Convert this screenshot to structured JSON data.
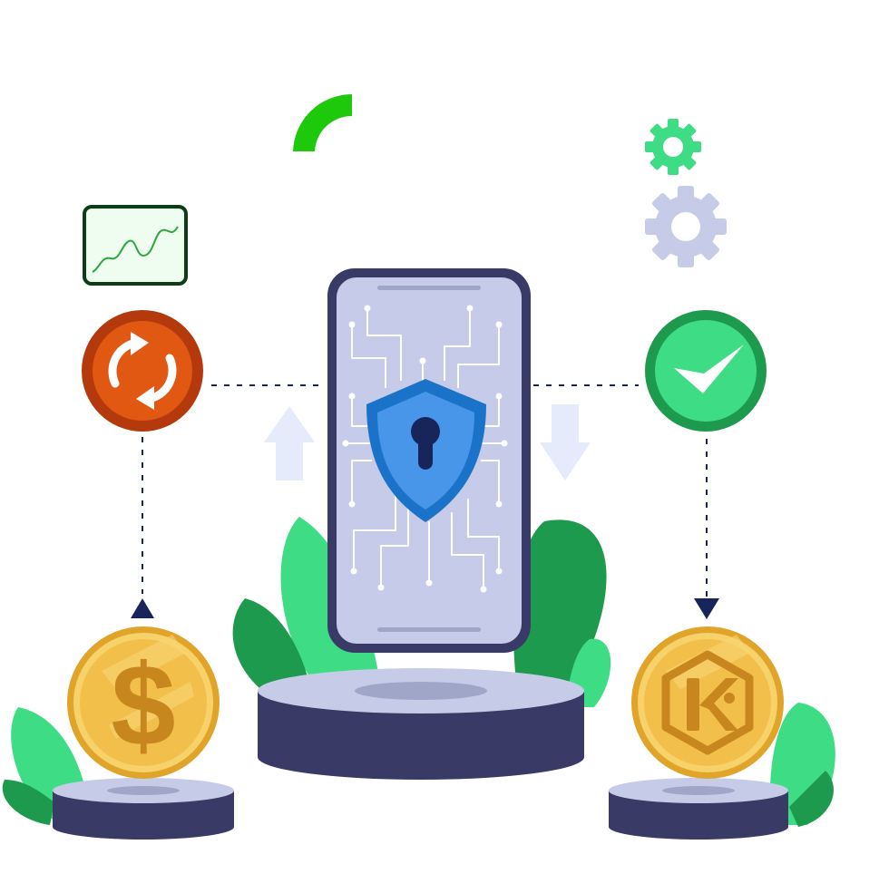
{
  "illustration": {
    "theme": "secure-crypto-exchange",
    "colors": {
      "leaf_light": "#3fdc86",
      "leaf_dark": "#1e9a4e",
      "pedestal_top": "#c6cbe8",
      "pedestal_side": "#3a3a66",
      "phone_frame": "#3a3a66",
      "phone_screen": "#c5cbe9",
      "shield_outer": "#1a73c8",
      "shield_inner": "#4796ea",
      "keyhole": "#17255a",
      "coin_rim": "#e0a42a",
      "coin_face": "#f2c04a",
      "coin_symbol": "#c8861e",
      "sync_outer": "#b43a0e",
      "sync_inner": "#e05812",
      "check_outer": "#1e9a4e",
      "check_inner": "#3fdc86",
      "arrow_soft": "#e6ebfb",
      "connector": "#17255a",
      "gear_small": "#3fdc86",
      "gear_large": "#c6cbe8",
      "arc": "#1ec80a",
      "chart_border": "#0a3d14",
      "chart_bg": "#effdf1",
      "chart_line": "#2aa83c"
    },
    "icons": {
      "left_coin": "dollar-coin-icon",
      "right_coin": "kucoin-coin-icon",
      "left_badge": "sync-icon",
      "right_badge": "check-icon",
      "center": "shield-lock-icon"
    },
    "left_coin_symbol": "$"
  }
}
